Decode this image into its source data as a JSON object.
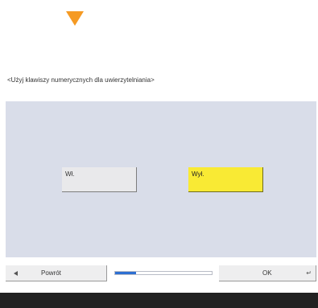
{
  "prompt": "<Użyj klawiszy numerycznych dla uwierzytelniania>",
  "options": {
    "on_label": "Wł.",
    "off_label": "Wył.",
    "selected": "off"
  },
  "footer": {
    "back_label": "Powrót",
    "ok_label": "OK",
    "enter_glyph": "↵",
    "progress_fraction": 0.22
  },
  "colors": {
    "indicator": "#f59a23",
    "panel": "#d9dde9",
    "selected": "#f9ea34",
    "progress": "#2d6fd2"
  },
  "icons": [
    "scroll-indicator-icon",
    "back-arrow-icon",
    "enter-icon"
  ]
}
